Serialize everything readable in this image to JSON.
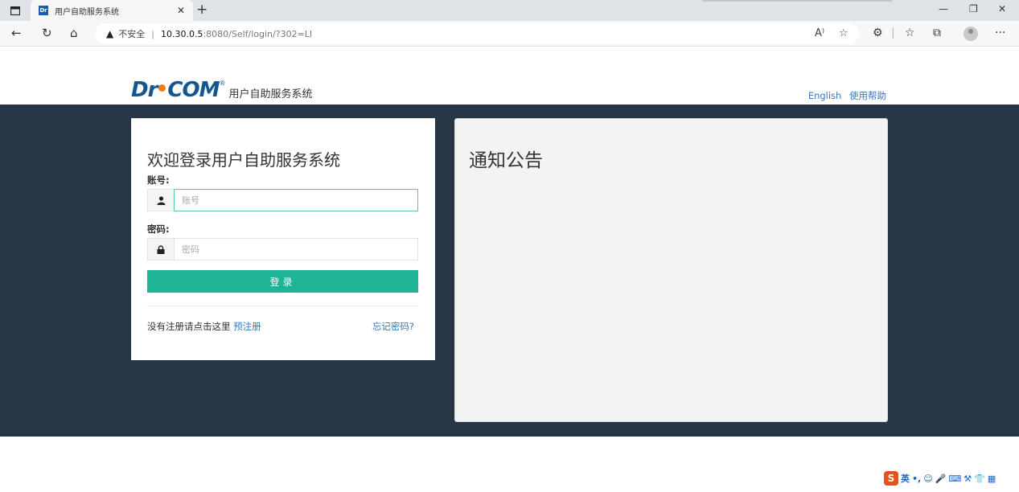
{
  "browser": {
    "tab_title": "用户自助服务系统",
    "tab_favicon": "Dr",
    "security_label": "不安全",
    "url_host": "10.30.0.5",
    "url_rest": ":8080/Self/login/?302=LI",
    "icons": [
      "sidebar-icon",
      "close-icon",
      "new-tab-icon",
      "back-icon",
      "refresh-icon",
      "home-icon",
      "warning-icon",
      "read-aloud-icon",
      "favorites-add-icon",
      "extensions-icon",
      "favorites-icon",
      "collections-icon",
      "profile-icon",
      "more-icon",
      "minimize-icon",
      "restore-icon"
    ]
  },
  "header": {
    "logo_mark": "Dr.COM",
    "logo_reg": "®",
    "logo_text": "用户自助服务系统",
    "links": {
      "english": "English",
      "help": "使用帮助"
    }
  },
  "login": {
    "title": "欢迎登录用户自助服务系统",
    "account_label": "账号:",
    "account_placeholder": "账号",
    "password_label": "密码:",
    "password_placeholder": "密码",
    "submit": "登录",
    "no_register": "没有注册请点击这里",
    "preregister": "预注册",
    "forgot": "忘记密码?"
  },
  "notice": {
    "title": "通知公告"
  },
  "ime": {
    "logo": "S",
    "lang": "英"
  },
  "colors": {
    "band": "#263645",
    "accent": "#1fb495",
    "link": "#3a78b5",
    "logo_blue": "#16568f",
    "logo_orange": "#f07b1a"
  }
}
